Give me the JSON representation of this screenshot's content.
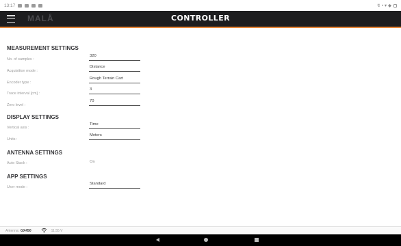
{
  "status_bar": {
    "time": "13:17",
    "right_text": "↯ • ▾ ◆"
  },
  "app_bar": {
    "brand": "MALÅ",
    "title": "CONTROLLER"
  },
  "measurement_settings": {
    "title": "MEASUREMENT SETTINGS",
    "fields": [
      {
        "label": "No. of samples :",
        "value": "320"
      },
      {
        "label": "Acquisition mode :",
        "value": "Distance"
      },
      {
        "label": "Encoder type :",
        "value": "Rough Terrain Cart"
      },
      {
        "label": "Trace interval [cm] :",
        "value": "3"
      },
      {
        "label": "Zero level :",
        "value": "70"
      }
    ]
  },
  "display_settings": {
    "title": "DISPLAY SETTINGS",
    "fields": [
      {
        "label": "Vertical axis :",
        "value": "Time"
      },
      {
        "label": "Units :",
        "value": "Meters"
      }
    ]
  },
  "antenna_settings": {
    "title": "ANTENNA SETTINGS",
    "fields": [
      {
        "label": "Auto Stack :",
        "value": "On"
      }
    ]
  },
  "app_settings": {
    "title": "APP SETTINGS",
    "fields": [
      {
        "label": "User mode :",
        "value": "Standard"
      }
    ]
  },
  "bottom_info": {
    "antenna_label": "Antenna:",
    "antenna_value": "GX450",
    "voltage": "11.55 V"
  },
  "colors": {
    "app_bar": "#1d1d1f",
    "accent": "#e9883a",
    "nav_bar": "#000000"
  },
  "icons": {
    "menu": "hamburger-menu-icon",
    "signal": "signal-icon",
    "back": "back-triangle-icon",
    "home": "home-circle-icon",
    "recents": "recents-square-icon"
  }
}
